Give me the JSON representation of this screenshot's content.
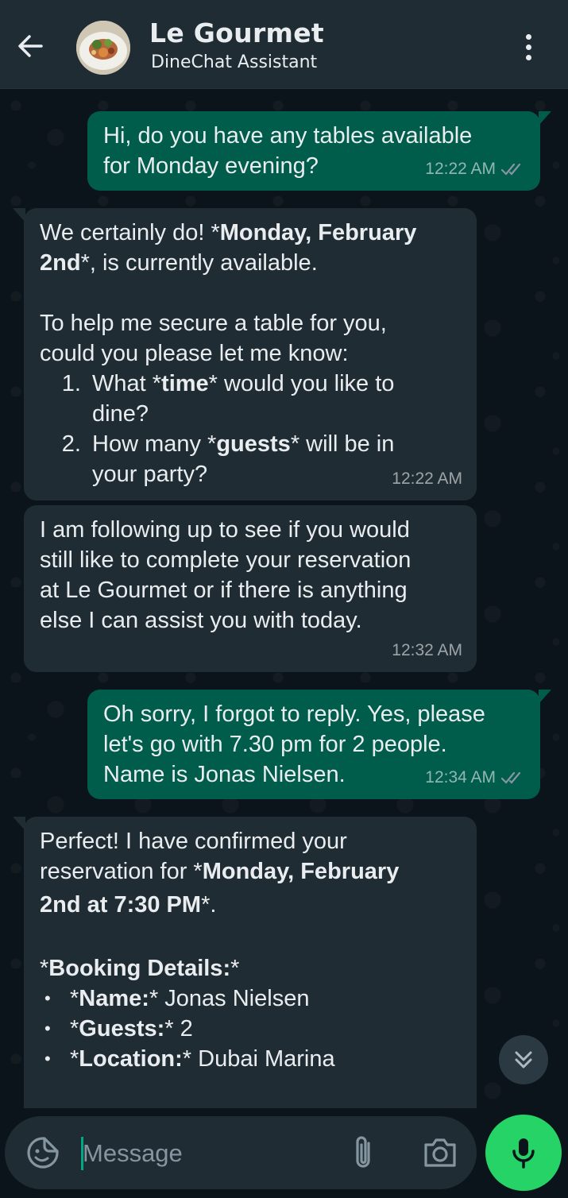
{
  "header": {
    "title": "Le Gourmet",
    "subtitle": "DineChat Assistant"
  },
  "messages": [
    {
      "direction": "out",
      "lines": [
        "Hi, do you have any tables available",
        "for Monday evening?"
      ],
      "time": "12:22 AM",
      "status": "read"
    },
    {
      "direction": "in",
      "line1_prefix": "We certainly do! *",
      "line1_bold": "Monday, February",
      "line2_bold": "2nd",
      "line2_suffix": "*, is currently available.",
      "para2_l1": "To help me secure a table for you,",
      "para2_l2": "could you please let me know:",
      "item1_prefix": "What *",
      "item1_bold": "time",
      "item1_suffix": "* would you like to dine?",
      "item2_prefix": "How many *",
      "item2_bold": "guests",
      "item2_suffix": "* will be in your party?",
      "time": "12:22 AM"
    },
    {
      "direction": "in",
      "lines": [
        "I am following up to see if you would",
        "still like to complete your reservation",
        "at Le Gourmet or if there is anything",
        "else I can assist you with today."
      ],
      "time": "12:32 AM"
    },
    {
      "direction": "out",
      "lines": [
        "Oh sorry, I forgot to reply. Yes, please",
        "let's go with 7.30 pm for 2 people.",
        "Name is Jonas Nielsen."
      ],
      "time": "12:34 AM",
      "status": "read"
    },
    {
      "direction": "in",
      "l1": "Perfect! I have confirmed your",
      "l2_prefix": "reservation for *",
      "l2_bold": "Monday, February",
      "l3_bold": "2nd at 7:30 PM",
      "l3_suffix": "*.",
      "details_prefix": "*",
      "details_bold": "Booking Details:",
      "details_suffix": "*",
      "items": [
        {
          "prefix": "*",
          "bold": "Name:",
          "suffix": "* Jonas Nielsen"
        },
        {
          "prefix": "*",
          "bold": "Guests:",
          "suffix": "* 2"
        },
        {
          "prefix": "*",
          "bold": "Location:",
          "suffix": "* Dubai Marina"
        }
      ]
    }
  ],
  "composer": {
    "placeholder": "Message"
  },
  "colors": {
    "outgoing_bubble": "#005c4b",
    "incoming_bubble": "#202c33",
    "background": "#0b141a",
    "header": "#1f2c34",
    "accent": "#25d366",
    "read_ticks": "#8696a0"
  },
  "icons": {
    "back": "arrow-left-icon",
    "menu": "more-vertical-icon",
    "emoji": "sticker-smile-icon",
    "attach": "paperclip-icon",
    "camera": "camera-icon",
    "mic": "microphone-icon",
    "scroll": "double-chevron-down-icon"
  }
}
